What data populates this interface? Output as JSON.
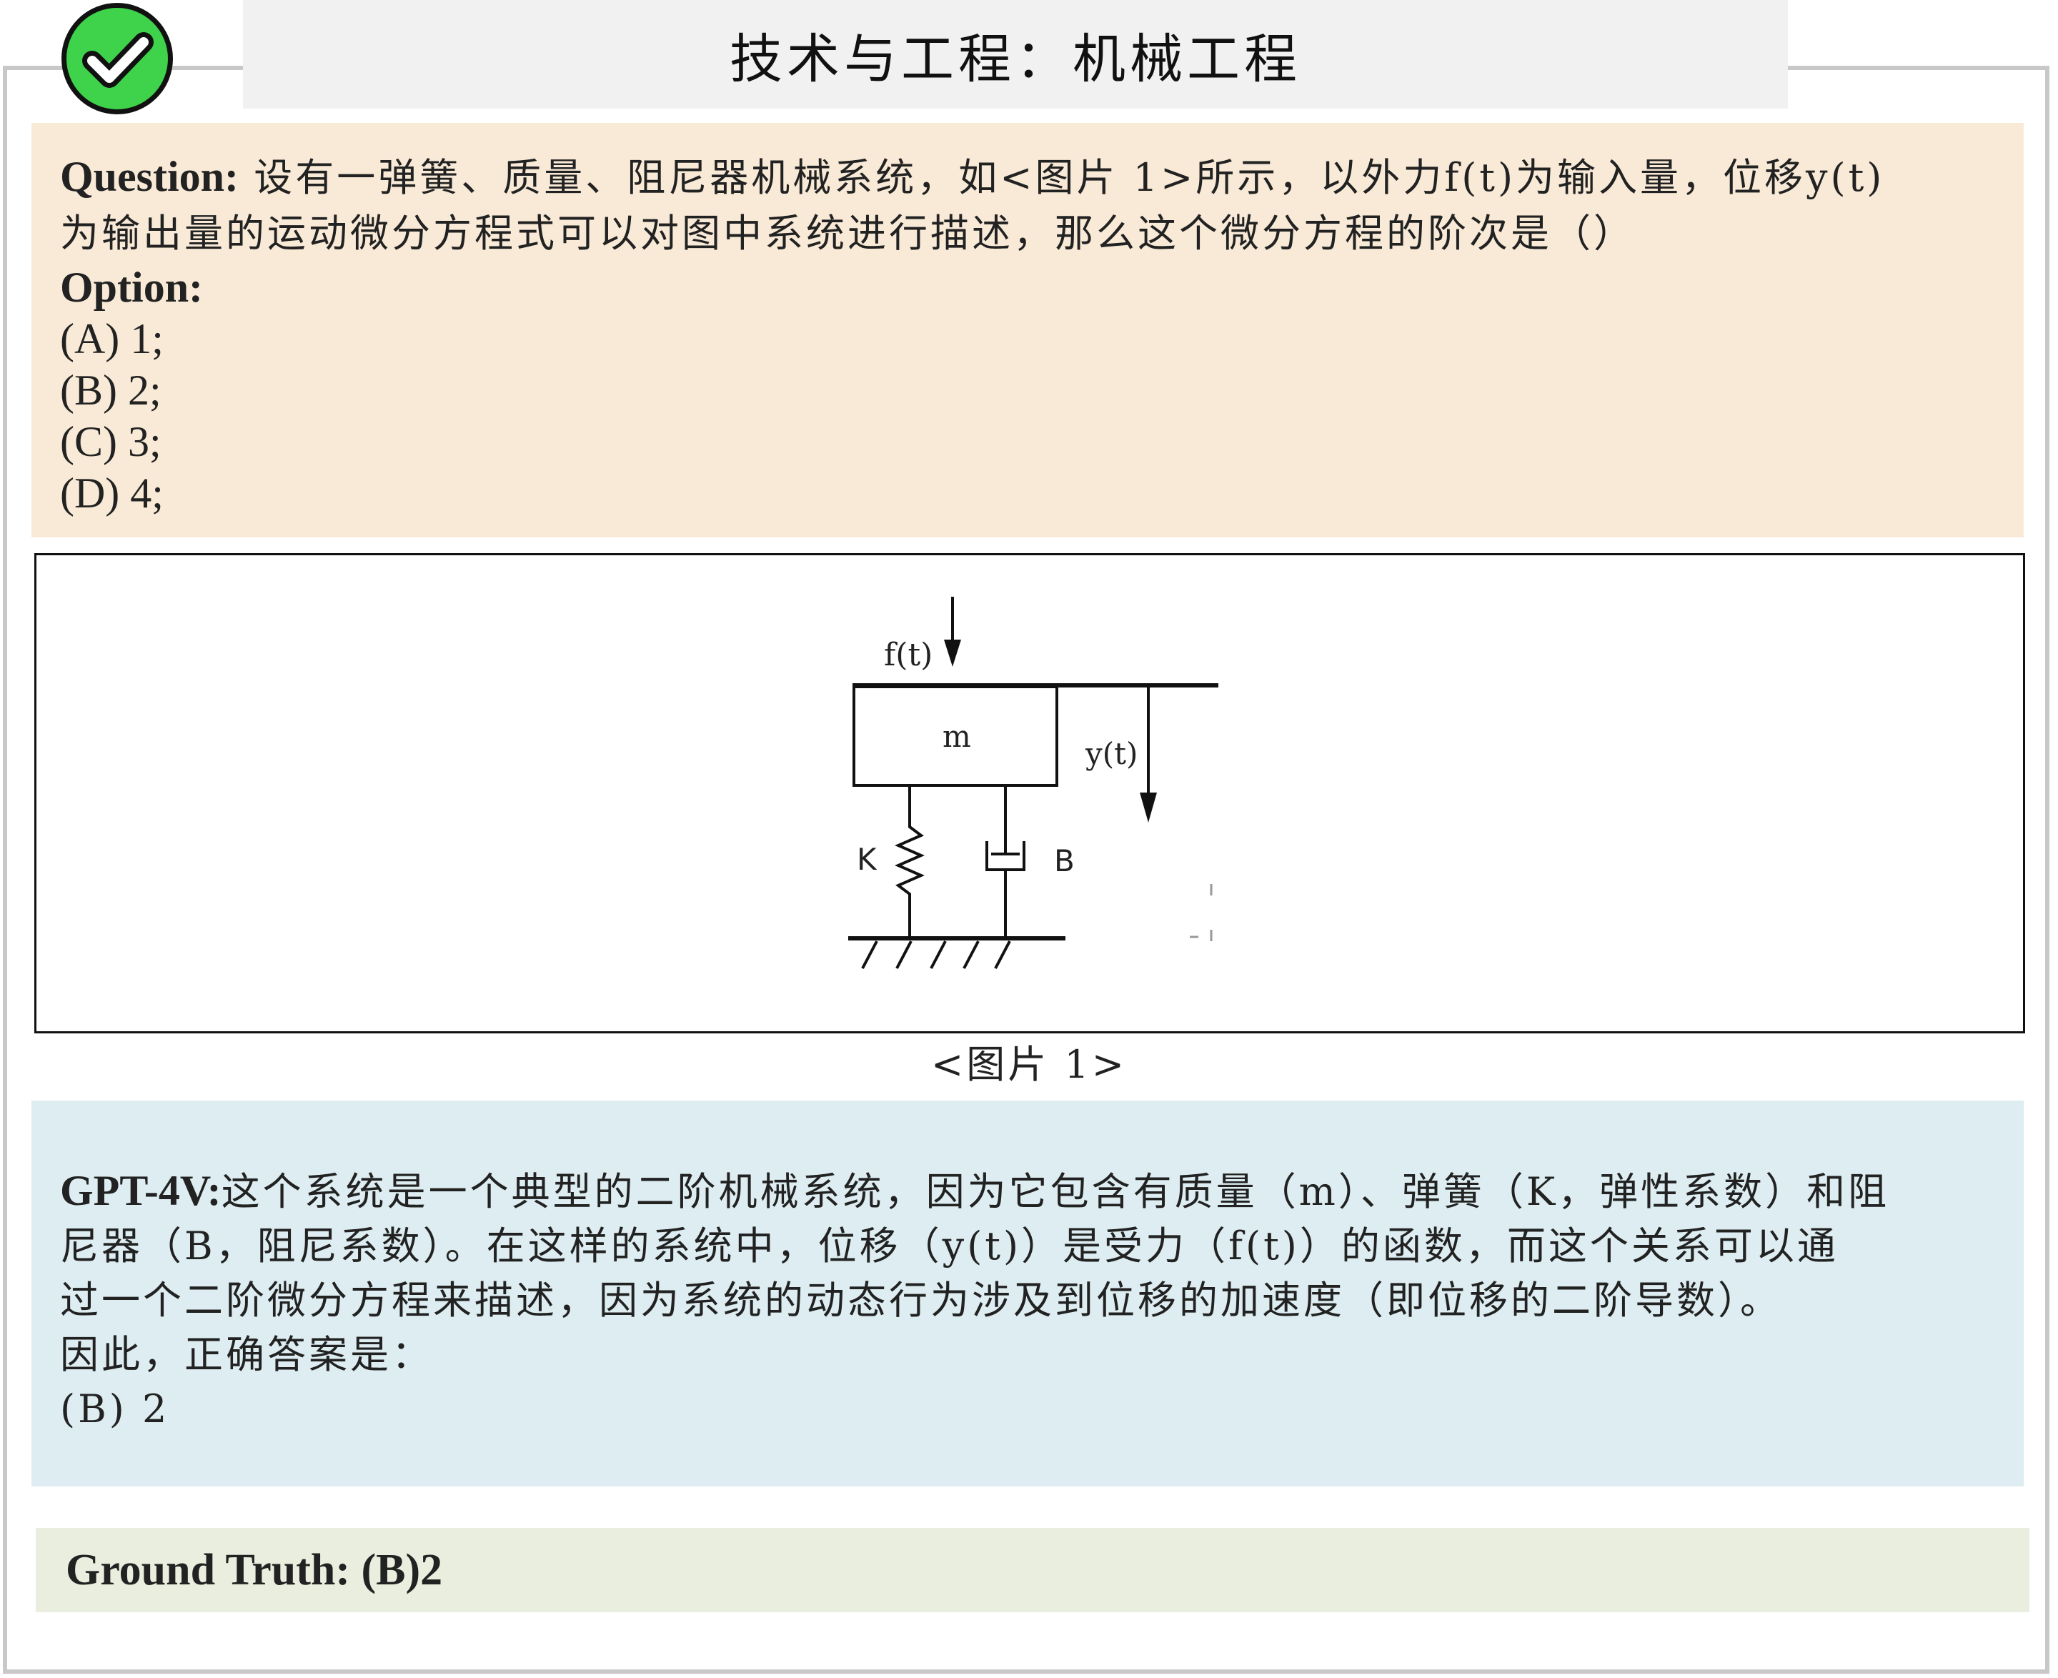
{
  "header": {
    "title": "技术与工程：机械工程",
    "status_icon": "check-icon",
    "status_color": "#3ed34a"
  },
  "question": {
    "label": "Question:",
    "line1": "设有一弹簧、质量、阻尼器机械系统，如<图片 1>所示，以外力f(t)为输入量，位移y(t)",
    "line2": "为输出量的运动微分方程式可以对图中系统进行描述，那么这个微分方程的阶次是（）",
    "option_label": "Option:",
    "options": [
      "(A) 1;",
      "(B) 2;",
      "(C) 3;",
      "(D) 4;"
    ]
  },
  "figure": {
    "caption": "<图片 1>",
    "labels": {
      "force": "f(t)",
      "mass": "m",
      "displacement": "y(t)",
      "spring": "K",
      "damper": "B"
    }
  },
  "answer": {
    "label": "GPT-4V:",
    "line1": "这个系统是一个典型的二阶机械系统，因为它包含有质量（m）、弹簧（K，弹性系数）和阻",
    "line2": "尼器（B，阻尼系数）。在这样的系统中，位移（y(t)）是受力（f(t)）的函数，而这个关系可以通",
    "line3": "过一个二阶微分方程来描述，因为系统的动态行为涉及到位移的加速度（即位移的二阶导数）。",
    "line4": "因此，正确答案是：",
    "line5": "(B) 2"
  },
  "ground_truth": {
    "text": "Ground Truth: (B)2"
  },
  "colors": {
    "question_bg": "#f8ead7",
    "answer_bg": "#ddedf1",
    "ground_truth_bg": "#eaeedf",
    "title_bg": "#f1f1f1"
  }
}
